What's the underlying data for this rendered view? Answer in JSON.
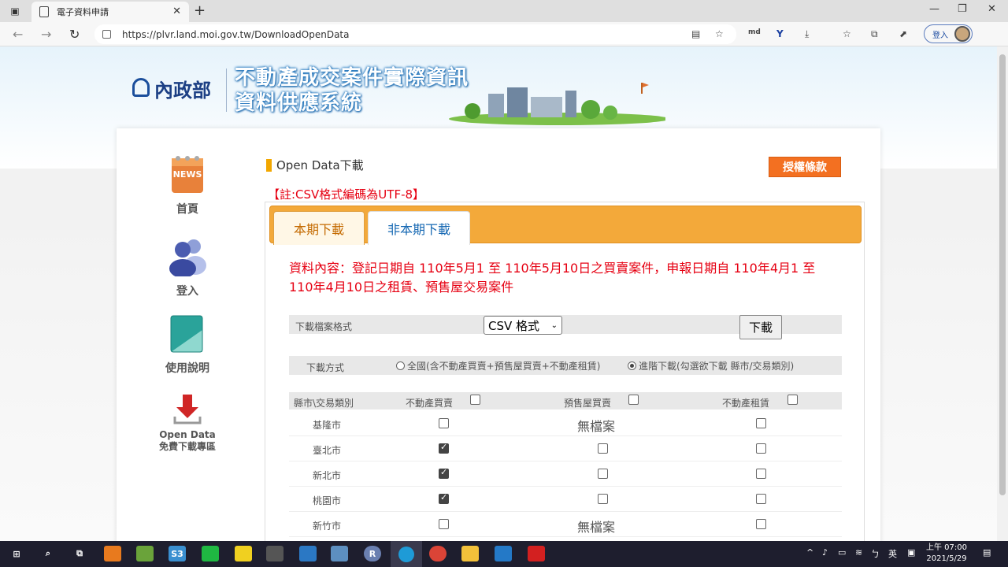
{
  "browser": {
    "tab_title": "電子資料申請",
    "url": "https://plvr.land.moi.gov.tw/DownloadOpenData",
    "signin_label": "登入",
    "md_label": "md",
    "tab_close": "✕",
    "new_tab": "+",
    "win_min": "—",
    "win_max": "❐",
    "win_close": "✕"
  },
  "header": {
    "ministry": "內政部",
    "system_title_line1": "不動產成交案件實際資訊",
    "system_title_line2": "資料供應系統"
  },
  "sidebar": {
    "items": [
      {
        "label": "首頁",
        "icon_text": "NEWS"
      },
      {
        "label": "登入"
      },
      {
        "label": "使用說明"
      },
      {
        "label": "Open Data",
        "sublabel": "免費下載專區"
      }
    ]
  },
  "main": {
    "section_title": "Open Data下載",
    "license_button": "授權條款",
    "note": "【註:CSV格式編碼為UTF-8】",
    "tabs": [
      {
        "label": "本期下載",
        "active": true
      },
      {
        "label": "非本期下載",
        "active": false
      }
    ],
    "description": "資料內容：登記日期自 110年5月1 至 110年5月10日之買賣案件，申報日期自 110年4月1 至 110年4月10日之租賃、預售屋交易案件",
    "format_label": "下載檔案格式",
    "format_value": "CSV 格式",
    "download_button": "下載",
    "method_label": "下載方式",
    "method_options": [
      {
        "label": "全國(含不動產買賣+預售屋買賣+不動產租賃)",
        "selected": false
      },
      {
        "label": "進階下載(勾選欲下載 縣市/交易類別)",
        "selected": true
      }
    ],
    "table": {
      "headers": [
        "縣市\\交易類別",
        "不動產買賣",
        "預售屋買賣",
        "不動產租賃"
      ],
      "no_file_text": "無檔案",
      "rows": [
        {
          "city": "基隆市",
          "sale": false,
          "presale": null,
          "rent": false
        },
        {
          "city": "臺北市",
          "sale": true,
          "presale": false,
          "rent": false
        },
        {
          "city": "新北市",
          "sale": true,
          "presale": false,
          "rent": false
        },
        {
          "city": "桃園市",
          "sale": true,
          "presale": false,
          "rent": false
        },
        {
          "city": "新竹市",
          "sale": false,
          "presale": null,
          "rent": false
        }
      ]
    }
  },
  "taskbar": {
    "ime_lang": "英",
    "time": "上午 07:00",
    "date": "2021/5/29"
  }
}
